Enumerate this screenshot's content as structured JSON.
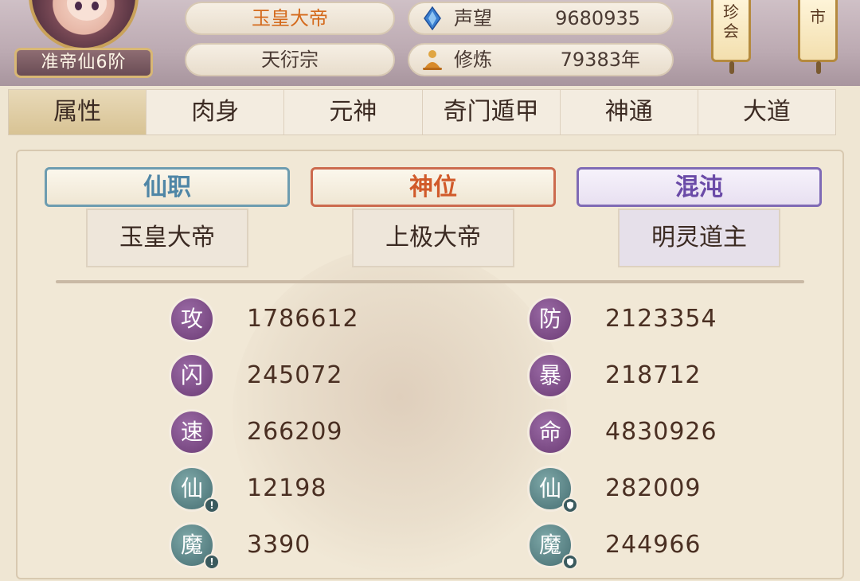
{
  "player": {
    "rank": "准帝仙6阶",
    "name": "玉皇大帝",
    "sect": "天衍宗",
    "reputation_label": "声望",
    "reputation_value": "9680935",
    "cultivation_label": "修炼",
    "cultivation_value": "79383年"
  },
  "lanterns": {
    "treasure_line1": "珍",
    "treasure_line2": "会",
    "market": "市"
  },
  "tabs": [
    "属性",
    "肉身",
    "元神",
    "奇门遁甲",
    "神通",
    "大道"
  ],
  "titles": {
    "immortal_post": {
      "label": "仙职",
      "value": "玉皇大帝"
    },
    "divine_rank": {
      "label": "神位",
      "value": "上极大帝"
    },
    "chaos": {
      "label": "混沌",
      "value": "明灵道主"
    }
  },
  "stats": {
    "left": [
      {
        "char": "攻",
        "value": "1786612"
      },
      {
        "char": "闪",
        "value": "245072"
      },
      {
        "char": "速",
        "value": "266209"
      },
      {
        "char": "仙",
        "value": "12198"
      },
      {
        "char": "魔",
        "value": "3390"
      }
    ],
    "right": [
      {
        "char": "防",
        "value": "2123354"
      },
      {
        "char": "暴",
        "value": "218712"
      },
      {
        "char": "命",
        "value": "4830926"
      },
      {
        "char": "仙",
        "value": "282009"
      },
      {
        "char": "魔",
        "value": "244966"
      }
    ]
  }
}
